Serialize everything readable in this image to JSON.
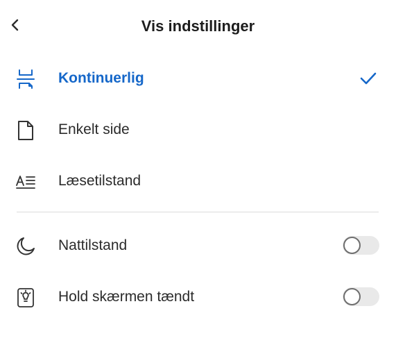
{
  "header": {
    "title": "Vis indstillinger",
    "back_icon": "chevron-left-icon"
  },
  "view_modes": [
    {
      "label": "Kontinuerlig",
      "icon": "continuous-scroll-icon",
      "selected": true
    },
    {
      "label": "Enkelt side",
      "icon": "single-page-icon",
      "selected": false
    },
    {
      "label": "Læsetilstand",
      "icon": "reading-mode-icon",
      "selected": false
    }
  ],
  "toggles": [
    {
      "label": "Nattilstand",
      "icon": "moon-icon",
      "on": false
    },
    {
      "label": "Hold skærmen tændt",
      "icon": "screen-lightbulb-icon",
      "on": false
    }
  ],
  "colors": {
    "accent": "#1567c9",
    "text": "#2b2b2b",
    "divider": "#dcdcdc",
    "toggle_off_track": "#e9e9e9"
  }
}
